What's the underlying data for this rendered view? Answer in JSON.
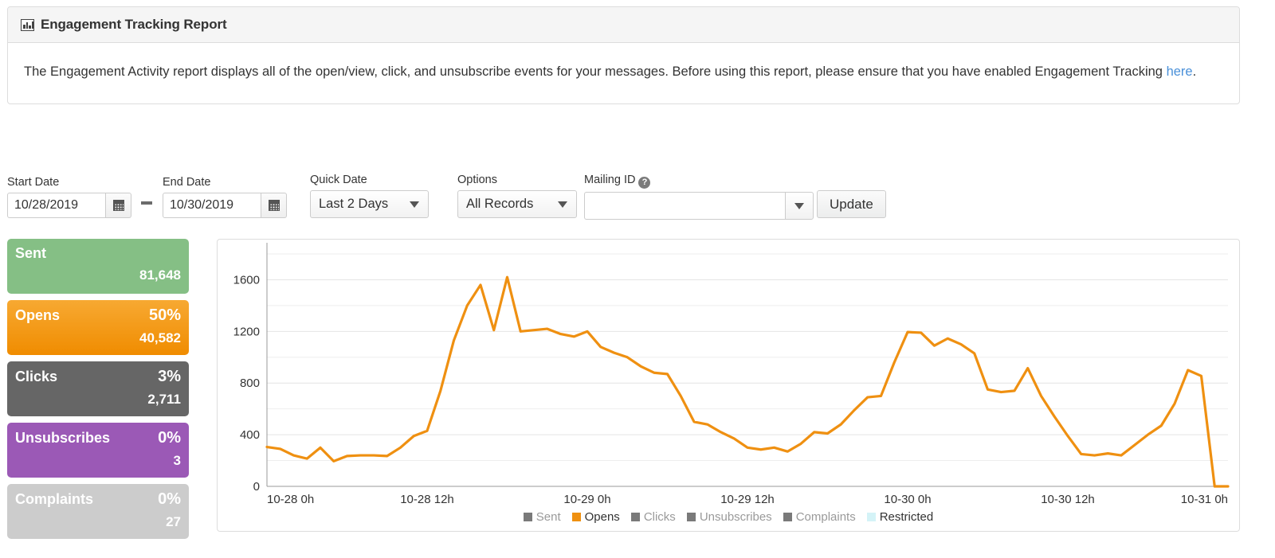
{
  "panel": {
    "icon": "bar-chart-icon",
    "title": "Engagement Tracking Report",
    "body_before": "The Engagement Activity report displays all of the open/view, click, and unsubscribe events for your messages. Before using this report, please ensure that you have enabled Engagement Tracking ",
    "link_text": "here",
    "body_after": "."
  },
  "filters": {
    "start_date": {
      "label": "Start Date",
      "value": "10/28/2019",
      "placeholder": "mm/dd/yyyy",
      "calendar_icon": "calendar-icon"
    },
    "separator": "-",
    "end_date": {
      "label": "End Date",
      "value": "10/30/2019",
      "placeholder": "mm/dd/yyyy",
      "calendar_icon": "calendar-icon"
    },
    "quick_date": {
      "label": "Quick Date",
      "value": "Last 2 Days",
      "options": [
        "Last 2 Days"
      ]
    },
    "options": {
      "label": "Options",
      "value": "All Records",
      "options": [
        "All Records"
      ]
    },
    "mailing_id": {
      "label": "Mailing ID",
      "value": "",
      "placeholder": "",
      "help_icon": "help-icon"
    },
    "update": {
      "label": "Update"
    }
  },
  "stats": [
    {
      "name": "Sent",
      "pct": "",
      "value": "81,648",
      "color": "#85bf85"
    },
    {
      "name": "Opens",
      "pct": "50%",
      "value": "40,582",
      "color": "#f08c00"
    },
    {
      "name": "Clicks",
      "pct": "3%",
      "value": "2,711",
      "color": "#666666"
    },
    {
      "name": "Unsubscribes",
      "pct": "0%",
      "value": "3",
      "color": "#9b59b6"
    },
    {
      "name": "Complaints",
      "pct": "0%",
      "value": "27",
      "color": "#cccccc"
    }
  ],
  "chart_data": {
    "type": "line",
    "title": "",
    "xlabel": "",
    "ylabel": "",
    "ylim": [
      0,
      1800
    ],
    "yticks": [
      0,
      400,
      800,
      1200,
      1600
    ],
    "ytick_labels": [
      "0",
      "400",
      "800",
      "1200",
      "1600"
    ],
    "minor_gridlines": [
      200,
      600,
      1000,
      1400,
      1800
    ],
    "grid": true,
    "legend_position": "bottom",
    "xticks": [
      0,
      12,
      24,
      36,
      48,
      60,
      72
    ],
    "xtick_labels": [
      "10-28 0h",
      "10-28 12h",
      "10-29 0h",
      "10-29 12h",
      "10-30 0h",
      "10-30 12h",
      "10-31 0h"
    ],
    "x": [
      0,
      1,
      2,
      3,
      4,
      5,
      6,
      7,
      8,
      9,
      10,
      11,
      12,
      13,
      14,
      15,
      16,
      17,
      18,
      19,
      20,
      21,
      22,
      23,
      24,
      25,
      26,
      27,
      28,
      29,
      30,
      31,
      32,
      33,
      34,
      35,
      36,
      37,
      38,
      39,
      40,
      41,
      42,
      43,
      44,
      45,
      46,
      47,
      48,
      49,
      50,
      51,
      52,
      53,
      54,
      55,
      56,
      57,
      58,
      59,
      60,
      61,
      62,
      63,
      64,
      65,
      66,
      67,
      68,
      69,
      70,
      71,
      72
    ],
    "series": [
      {
        "name": "Sent",
        "color": "#7a7a7a",
        "active": false,
        "values": []
      },
      {
        "name": "Opens",
        "color": "#ef9011",
        "active": true,
        "values": [
          305,
          290,
          240,
          215,
          300,
          195,
          235,
          240,
          240,
          235,
          300,
          390,
          430,
          740,
          1130,
          1400,
          1560,
          1210,
          1620,
          1200,
          1210,
          1220,
          1180,
          1160,
          1200,
          1080,
          1035,
          1000,
          930,
          880,
          870,
          700,
          500,
          480,
          420,
          370,
          300,
          285,
          300,
          270,
          330,
          420,
          410,
          480,
          590,
          690,
          700,
          960,
          1195,
          1190,
          1090,
          1145,
          1100,
          1030,
          750,
          730,
          740,
          915,
          700,
          540,
          390,
          250,
          240,
          255,
          240,
          320,
          400,
          470,
          640,
          900,
          855,
          0,
          0,
          0
        ]
      },
      {
        "name": "Clicks",
        "color": "#7a7a7a",
        "active": false,
        "values": []
      },
      {
        "name": "Unsubscribes",
        "color": "#7a7a7a",
        "active": false,
        "values": []
      },
      {
        "name": "Complaints",
        "color": "#7a7a7a",
        "active": false,
        "values": []
      },
      {
        "name": "Restricted",
        "color": "#d4f3f7",
        "active": true,
        "values": []
      }
    ]
  }
}
